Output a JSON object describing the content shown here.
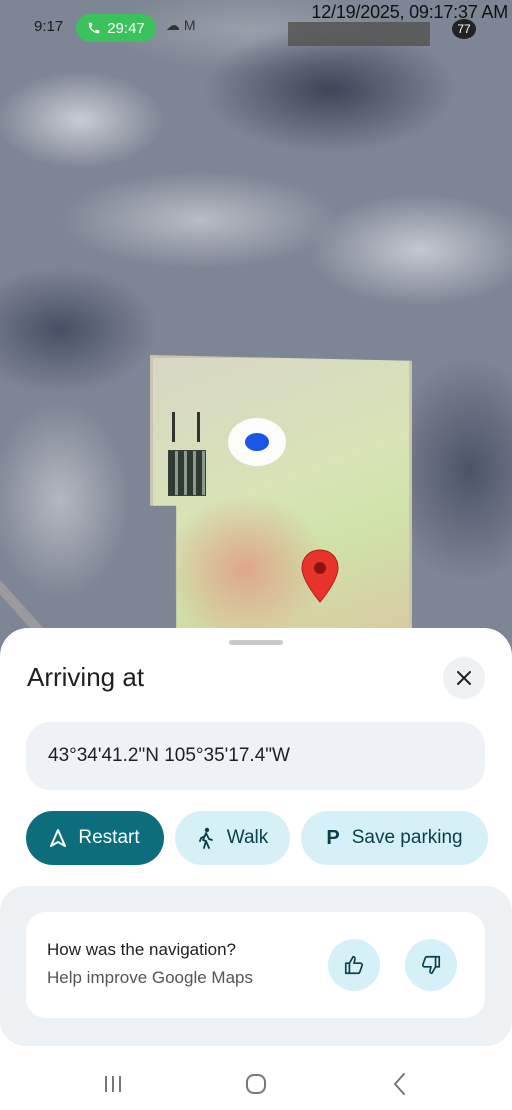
{
  "status_bar": {
    "time": "9:17",
    "call_timer": "29:47",
    "icons": "☁ M",
    "timestamp": "12/19/2025, 09:17:37 AM",
    "right_badge": "77"
  },
  "map": {
    "style": "satellite",
    "current_location_color": "#1a55e8",
    "destination_pin_color": "#e8332d"
  },
  "sheet": {
    "title": "Arriving at",
    "destination": "43°34'41.2\"N 105°35'17.4\"W",
    "buttons": {
      "restart": "Restart",
      "walk": "Walk",
      "save_parking_icon": "P",
      "save_parking": "Save parking"
    },
    "feedback": {
      "question": "How was the navigation?",
      "subtitle": "Help improve Google Maps"
    }
  },
  "colors": {
    "primary": "#0c6d7d",
    "tonal_button": "#d6f0f8",
    "surface_variant": "#eef1f4"
  }
}
